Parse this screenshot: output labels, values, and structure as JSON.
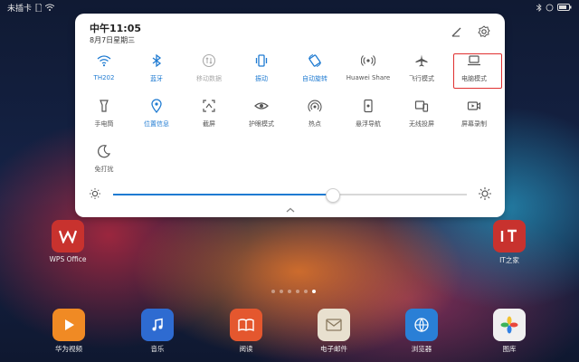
{
  "status_bar": {
    "carrier": "未插卡",
    "battery": ""
  },
  "panel": {
    "time": "中午11:05",
    "date": "8月7日星期三",
    "edit_icon": "pencil-icon",
    "settings_icon": "gear-icon",
    "tiles": [
      {
        "label": "TH202",
        "icon": "wifi-icon",
        "state": "on"
      },
      {
        "label": "蓝牙",
        "icon": "bluetooth-icon",
        "state": "on"
      },
      {
        "label": "移动数据",
        "icon": "mobile-data-icon",
        "state": "disabled"
      },
      {
        "label": "振动",
        "icon": "vibrate-icon",
        "state": "on"
      },
      {
        "label": "自动旋转",
        "icon": "rotate-icon",
        "state": "on"
      },
      {
        "label": "Huawei Share",
        "icon": "share-icon",
        "state": "off"
      },
      {
        "label": "飞行模式",
        "icon": "airplane-icon",
        "state": "off"
      },
      {
        "label": "电脑模式",
        "icon": "laptop-icon",
        "state": "off"
      },
      {
        "label": "手电筒",
        "icon": "flashlight-icon",
        "state": "off"
      },
      {
        "label": "位置信息",
        "icon": "location-icon",
        "state": "on"
      },
      {
        "label": "截屏",
        "icon": "screenshot-icon",
        "state": "off"
      },
      {
        "label": "护眼模式",
        "icon": "eye-icon",
        "state": "off"
      },
      {
        "label": "热点",
        "icon": "hotspot-icon",
        "state": "off"
      },
      {
        "label": "悬浮导航",
        "icon": "float-nav-icon",
        "state": "off"
      },
      {
        "label": "无线投屏",
        "icon": "cast-icon",
        "state": "off"
      },
      {
        "label": "屏幕录制",
        "icon": "record-icon",
        "state": "off"
      },
      {
        "label": "免打扰",
        "icon": "moon-icon",
        "state": "off"
      }
    ],
    "brightness": 0.62
  },
  "apps_row1": [
    {
      "label": "WPS Office",
      "icon": "wps-icon",
      "color": "#c8322e"
    },
    {
      "label": "IT之家",
      "icon": "ithome-icon",
      "color": "#c8322e"
    }
  ],
  "dock": [
    {
      "label": "华为视频",
      "icon": "video-icon",
      "color": "#f08a24"
    },
    {
      "label": "音乐",
      "icon": "music-icon",
      "color": "#2e6bd1"
    },
    {
      "label": "阅读",
      "icon": "book-icon",
      "color": "#e4572e"
    },
    {
      "label": "电子邮件",
      "icon": "mail-icon",
      "color": "#e8e0cf"
    },
    {
      "label": "浏览器",
      "icon": "browser-icon",
      "color": "#2a7fd6"
    },
    {
      "label": "图库",
      "icon": "gallery-icon",
      "color": "#f0f0f0"
    }
  ]
}
